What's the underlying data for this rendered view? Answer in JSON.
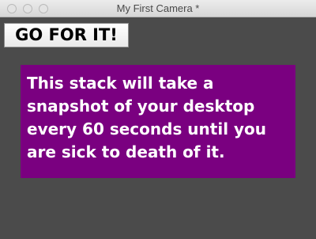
{
  "window": {
    "title": "My First Camera *"
  },
  "toolbar": {
    "go_label": "GO FOR IT!"
  },
  "message": {
    "text": "This stack will take a snapshot of your desktop every 60 seconds until you are sick to death of it."
  },
  "colors": {
    "background": "#4b4b4b",
    "accent": "#7a0080"
  },
  "icons": {
    "close": "close-icon",
    "minimize": "minimize-icon",
    "zoom": "zoom-icon"
  }
}
